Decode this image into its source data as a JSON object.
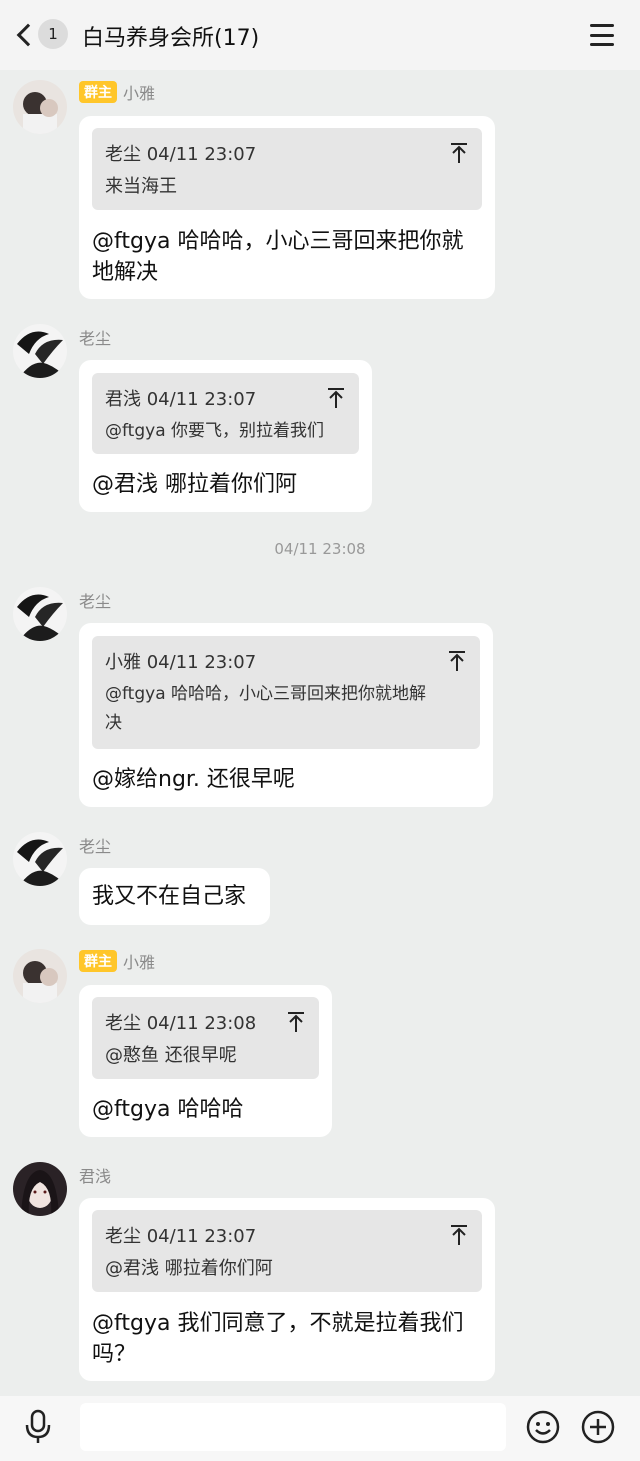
{
  "header": {
    "unread_count": "1",
    "title": "白马养身会所(17)"
  },
  "messages": [
    {
      "sender": "小雅",
      "badge": "群主",
      "quote_head": "老尘 04/11 23:07",
      "quote_text": "来当海王",
      "text_line1": "@ftgya 哈哈哈，小心三哥回来把你就",
      "text_line2": "地解决"
    },
    {
      "sender": "老尘",
      "quote_head": "君浅 04/11 23:07",
      "quote_text": "@ftgya 你要飞，别拉着我们",
      "text_line1": "@君浅 哪拉着你们阿"
    },
    {
      "sender": "老尘",
      "quote_head": "小雅 04/11 23:07",
      "quote_text_line1": "@ftgya 哈哈哈，小心三哥回来把你就地解",
      "quote_text_line2": "决",
      "text_line1": "@嫁给ngr. 还很早呢"
    },
    {
      "sender": "老尘",
      "text_line1": "我又不在自己家"
    },
    {
      "sender": "小雅",
      "badge": "群主",
      "quote_head": "老尘 04/11 23:08",
      "quote_text": "@憨鱼 还很早呢",
      "text_line1": "@ftgya 哈哈哈"
    },
    {
      "sender": "君浅",
      "quote_head": "老尘 04/11 23:07",
      "quote_text": "@君浅 哪拉着你们阿",
      "text_line1": "@ftgya 我们同意了，不就是拉着我们",
      "text_line2": "吗？"
    }
  ],
  "time_divider": "04/11 23:08",
  "bottom": {
    "icons": [
      "mic-icon",
      "emoji-icon",
      "plus-icon"
    ]
  },
  "colors": {
    "chat_background": "#eceeed",
    "bubble": "#ffffff",
    "quote_background": "#e6e6e6",
    "owner_badge": "#ffc62a"
  }
}
